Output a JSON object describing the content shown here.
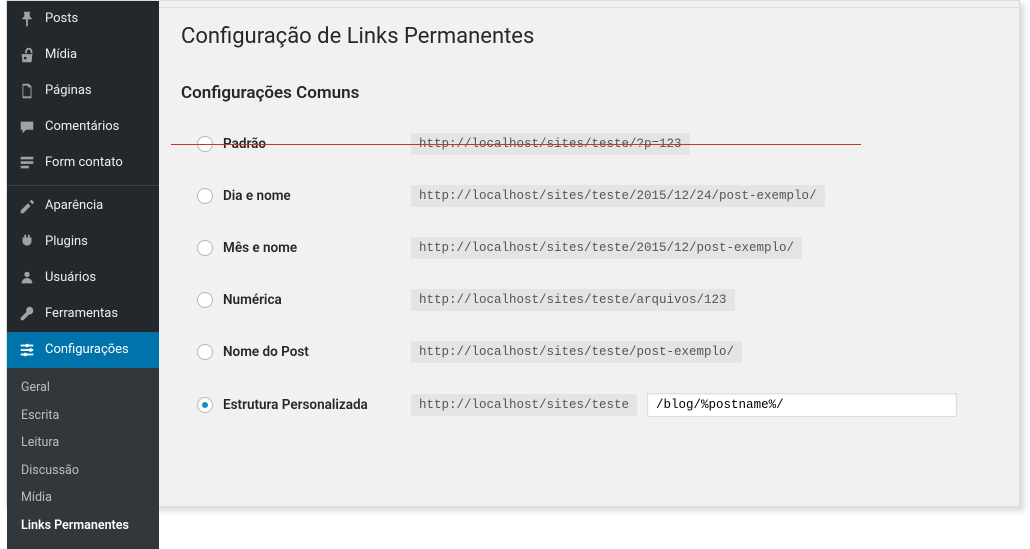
{
  "sidebar": {
    "items": [
      {
        "label": "Posts",
        "icon": "pin"
      },
      {
        "label": "Mídia",
        "icon": "media"
      },
      {
        "label": "Páginas",
        "icon": "page"
      },
      {
        "label": "Comentários",
        "icon": "comment"
      },
      {
        "label": "Form contato",
        "icon": "form"
      },
      {
        "label": "Aparência",
        "icon": "appearance",
        "sep": true
      },
      {
        "label": "Plugins",
        "icon": "plugin"
      },
      {
        "label": "Usuários",
        "icon": "users"
      },
      {
        "label": "Ferramentas",
        "icon": "tools"
      },
      {
        "label": "Configurações",
        "icon": "settings",
        "current": true
      }
    ],
    "submenu": [
      {
        "label": "Geral"
      },
      {
        "label": "Escrita"
      },
      {
        "label": "Leitura"
      },
      {
        "label": "Discussão"
      },
      {
        "label": "Mídia"
      },
      {
        "label": "Links Permanentes",
        "active": true
      }
    ]
  },
  "page": {
    "title": "Configuração de Links Permanentes",
    "section": "Configurações Comuns"
  },
  "options": [
    {
      "label": "Padrão",
      "example": "http://localhost/sites/teste/?p=123",
      "strike": true
    },
    {
      "label": "Dia e nome",
      "example": "http://localhost/sites/teste/2015/12/24/post-exemplo/"
    },
    {
      "label": "Mês e nome",
      "example": "http://localhost/sites/teste/2015/12/post-exemplo/"
    },
    {
      "label": "Numérica",
      "example": "http://localhost/sites/teste/arquivos/123"
    },
    {
      "label": "Nome do Post",
      "example": "http://localhost/sites/teste/post-exemplo/"
    },
    {
      "label": "Estrutura Personalizada",
      "prefix": "http://localhost/sites/teste",
      "value": "/blog/%postname%/",
      "custom": true,
      "checked": true
    }
  ]
}
